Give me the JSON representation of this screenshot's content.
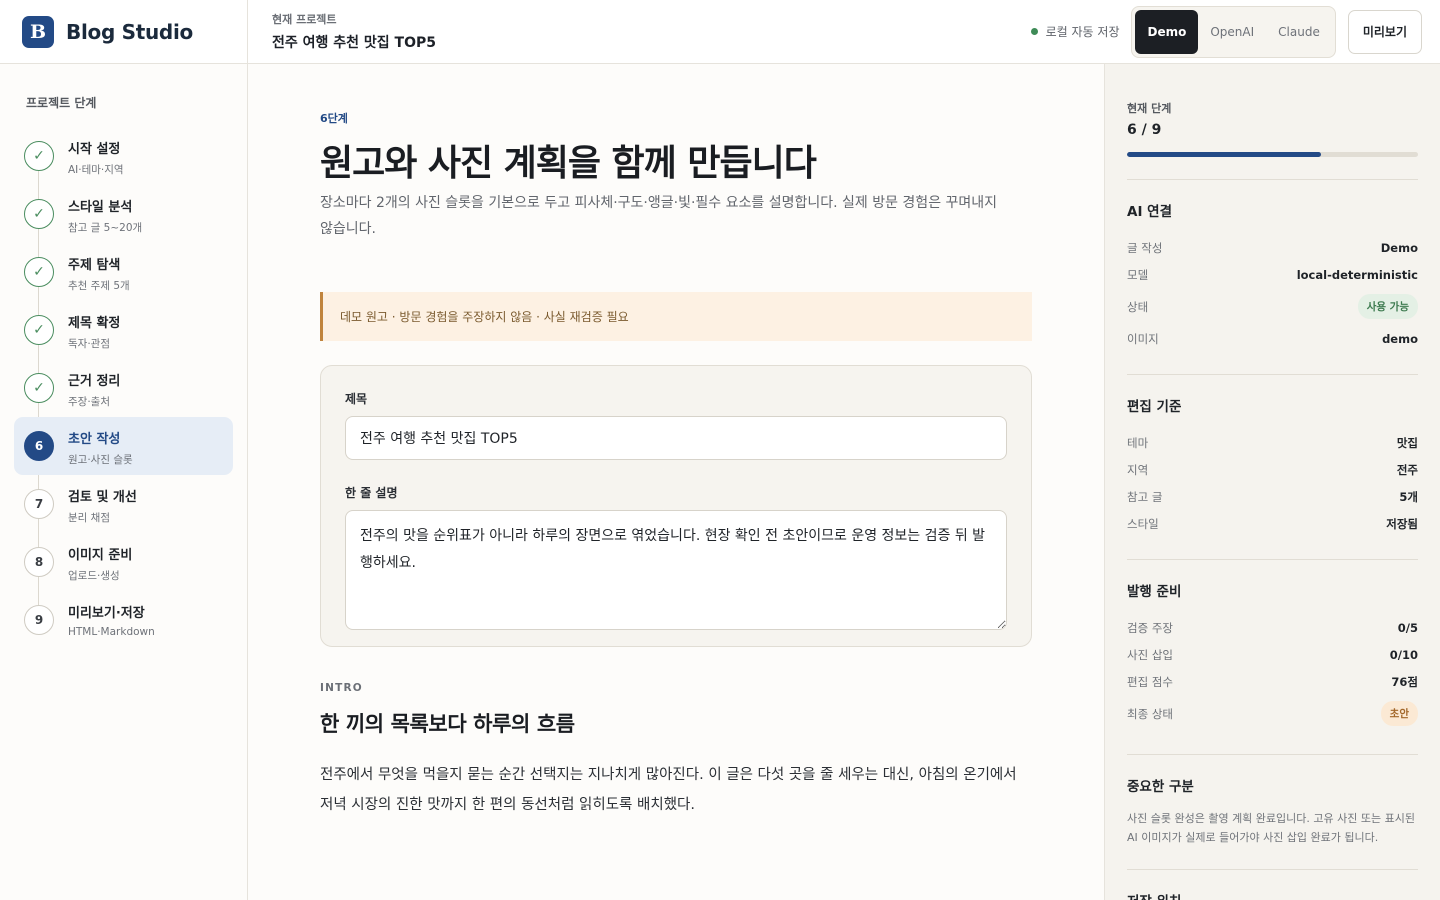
{
  "header": {
    "brand_letter": "B",
    "brand_name": "Blog Studio",
    "project_label": "현재 프로젝트",
    "project_name": "전주 여행 추천 맛집 TOP5",
    "save_status": "로컬 자동 저장",
    "providers": [
      "Demo",
      "OpenAI",
      "Claude"
    ],
    "active_provider": "Demo",
    "preview_label": "미리보기"
  },
  "sidebar": {
    "title": "프로젝트 단계",
    "steps": [
      {
        "num": "1",
        "name": "시작 설정",
        "sub": "AI·테마·지역",
        "state": "done"
      },
      {
        "num": "2",
        "name": "스타일 분석",
        "sub": "참고 글 5~20개",
        "state": "done"
      },
      {
        "num": "3",
        "name": "주제 탐색",
        "sub": "추천 주제 5개",
        "state": "done"
      },
      {
        "num": "4",
        "name": "제목 확정",
        "sub": "독자·관점",
        "state": "done"
      },
      {
        "num": "5",
        "name": "근거 정리",
        "sub": "주장·출처",
        "state": "done"
      },
      {
        "num": "6",
        "name": "초안 작성",
        "sub": "원고·사진 슬롯",
        "state": "current"
      },
      {
        "num": "7",
        "name": "검토 및 개선",
        "sub": "분리 채점",
        "state": "todo"
      },
      {
        "num": "8",
        "name": "이미지 준비",
        "sub": "업로드·생성",
        "state": "todo"
      },
      {
        "num": "9",
        "name": "미리보기·저장",
        "sub": "HTML·Markdown",
        "state": "todo"
      }
    ],
    "check_glyph": "✓"
  },
  "main": {
    "step_tag": "6단계",
    "title": "원고와 사진 계획을 함께 만듭니다",
    "description": "장소마다 2개의 사진 슬롯을 기본으로 두고 피사체·구도·앵글·빛·필수 요소를 설명합니다. 실제 방문 경험은 꾸며내지 않습니다.",
    "notice": "데모 원고 · 방문 경험을 주장하지 않음 · 사실 재검증 필요",
    "form": {
      "title_label": "제목",
      "title_value": "전주 여행 추천 맛집 TOP5",
      "summary_label": "한 줄 설명",
      "summary_value": "전주의 맛을 순위표가 아니라 하루의 장면으로 엮었습니다. 현장 확인 전 초안이므로 운영 정보는 검증 뒤 발행하세요."
    },
    "intro": {
      "tag": "INTRO",
      "title": "한 끼의 목록보다 하루의 흐름",
      "body": "전주에서 무엇을 먹을지 묻는 순간 선택지는 지나치게 많아진다. 이 글은 다섯 곳을 줄 세우는 대신, 아침의 온기에서 저녁 시장의 진한 맛까지 한 편의 동선처럼 읽히도록 배치했다."
    }
  },
  "right_panel": {
    "progress_label": "현재 단계",
    "progress_text": "6 / 9",
    "progress_fraction": 0.667,
    "ai": {
      "heading": "AI 연결",
      "rows": [
        {
          "k": "글 작성",
          "v": "Demo"
        },
        {
          "k": "모델",
          "v": "local-deterministic"
        },
        {
          "k": "상태",
          "v": "사용 가능",
          "badge": "green"
        },
        {
          "k": "이미지",
          "v": "demo"
        }
      ]
    },
    "editorial": {
      "heading": "편집 기준",
      "rows": [
        {
          "k": "테마",
          "v": "맛집"
        },
        {
          "k": "지역",
          "v": "전주"
        },
        {
          "k": "참고 글",
          "v": "5개"
        },
        {
          "k": "스타일",
          "v": "저장됨"
        }
      ]
    },
    "publish": {
      "heading": "발행 준비",
      "rows": [
        {
          "k": "검증 주장",
          "v": "0/5"
        },
        {
          "k": "사진 삽입",
          "v": "0/10"
        },
        {
          "k": "편집 점수",
          "v": "76점"
        },
        {
          "k": "최종 상태",
          "v": "초안",
          "badge": "orange"
        }
      ]
    },
    "important": {
      "heading": "중요한 구분",
      "text": "사진 슬롯 완성은 촬영 계획 완료입니다. 고유 사진 또는 표시된 AI 이미지가 실제로 들어가야 사진 삽입 완료가 됩니다."
    },
    "storage": {
      "heading": "저장 위치"
    }
  },
  "colors": {
    "accent": "#234a86",
    "success": "#4a8d5f",
    "warning": "#c0843d"
  }
}
